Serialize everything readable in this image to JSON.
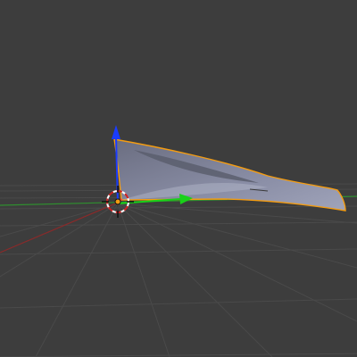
{
  "viewport": {
    "view": "3D Viewport",
    "background_color": "#3d3d3d",
    "grid_color": "#4a4a4a",
    "x_axis_color": "#8a2a2a",
    "y_axis_color": "#2f8f2f",
    "selection_outline_color": "#f39c12"
  },
  "scene": {
    "selected_object": {
      "kind": "mesh",
      "shape": "curved wedge",
      "selected": true,
      "fill_color": "#8b8fa8"
    },
    "origin": {
      "kind": "3d-cursor"
    },
    "gizmo": {
      "mode": "translate",
      "z_color": "#1a3cff",
      "y_color": "#19d119"
    }
  }
}
